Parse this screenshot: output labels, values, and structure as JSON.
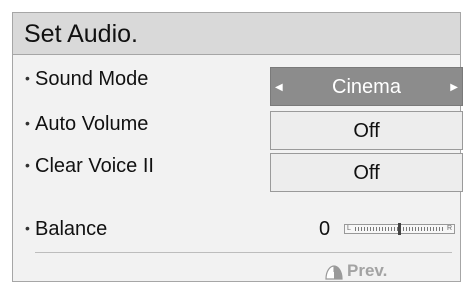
{
  "title": "Set Audio.",
  "settings": [
    {
      "label": "Sound Mode",
      "value": "Cinema"
    },
    {
      "label": "Auto Volume",
      "value": "Off"
    },
    {
      "label": "Clear Voice II",
      "value": "Off"
    },
    {
      "label": "Balance",
      "value": "0"
    }
  ],
  "balance": {
    "left_label": "L",
    "right_label": "R",
    "level": 0.5
  },
  "footer": {
    "prev_label": "Prev.",
    "icon": "mouse-icon"
  },
  "colors": {
    "selected_background": "#8c8c8c",
    "title_bar": "#d9d9d9",
    "panel_background": "#f2f2f2"
  }
}
